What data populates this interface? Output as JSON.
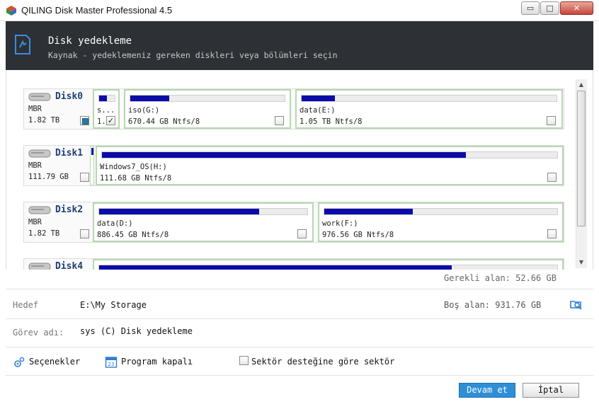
{
  "window": {
    "title": "QILING Disk Master Professional 4.5",
    "controls": [
      "▭",
      "□",
      "✕"
    ]
  },
  "header": {
    "title": "Disk yedekleme",
    "subtitle": "Kaynak - yedeklemeniz gereken diskleri veya bölümleri seçin"
  },
  "disks": [
    {
      "name": "Disk0",
      "type": "MBR",
      "size": "1.82 TB",
      "checked": "partial",
      "partitions": [
        {
          "name": "s...",
          "size": "1.",
          "used_fraction": 0.5,
          "checked": true
        },
        {
          "name": "iso(G:)",
          "size": "670.44 GB Ntfs/8",
          "used_fraction": 0.25,
          "checked": false
        },
        {
          "name": "data(E:)",
          "size": "1.05 TB Ntfs/8",
          "used_fraction": 0.13,
          "checked": false
        }
      ]
    },
    {
      "name": "Disk1",
      "type": "MBR",
      "size": "111.79 GB",
      "checked": "none",
      "partitions": [
        {
          "name": "",
          "size": "",
          "used_fraction": 1.0,
          "checked": false
        },
        {
          "name": "Windows7_OS(H:)",
          "size": "111.68 GB Ntfs/8",
          "used_fraction": 0.8,
          "checked": false
        }
      ]
    },
    {
      "name": "Disk2",
      "type": "MBR",
      "size": "1.82 TB",
      "checked": "none",
      "partitions": [
        {
          "name": "data(D:)",
          "size": "886.45 GB Ntfs/8",
          "used_fraction": 0.77,
          "checked": false
        },
        {
          "name": "work(F:)",
          "size": "976.56 GB Ntfs/8",
          "used_fraction": 0.38,
          "checked": false
        }
      ]
    },
    {
      "name": "Disk4",
      "type": "",
      "size": "",
      "checked": "none",
      "partitions": [
        {
          "name": "",
          "size": "",
          "used_fraction": 0.77,
          "checked": false
        }
      ]
    }
  ],
  "summary": {
    "required_label": "Gerekli alan: 52.66 GB"
  },
  "destination": {
    "label": "Hedef",
    "value": "E:\\My Storage",
    "free_space": "Boş alan: 931.76 GB"
  },
  "task": {
    "label": "Görev adı:",
    "value": "sys (C) Disk yedekleme"
  },
  "options": {
    "settings_label": "Seçenekler",
    "schedule_label": "Program kapalı",
    "sector_label": "Sektör desteğine göre sektör"
  },
  "buttons": {
    "next": "Devam et",
    "cancel": "İptal"
  },
  "colors": {
    "header_bg": "#2d3035",
    "usage_bar": "#0b0ba8",
    "partition_border": "#b6d8b0",
    "primary_button": "#2f8fd6"
  }
}
